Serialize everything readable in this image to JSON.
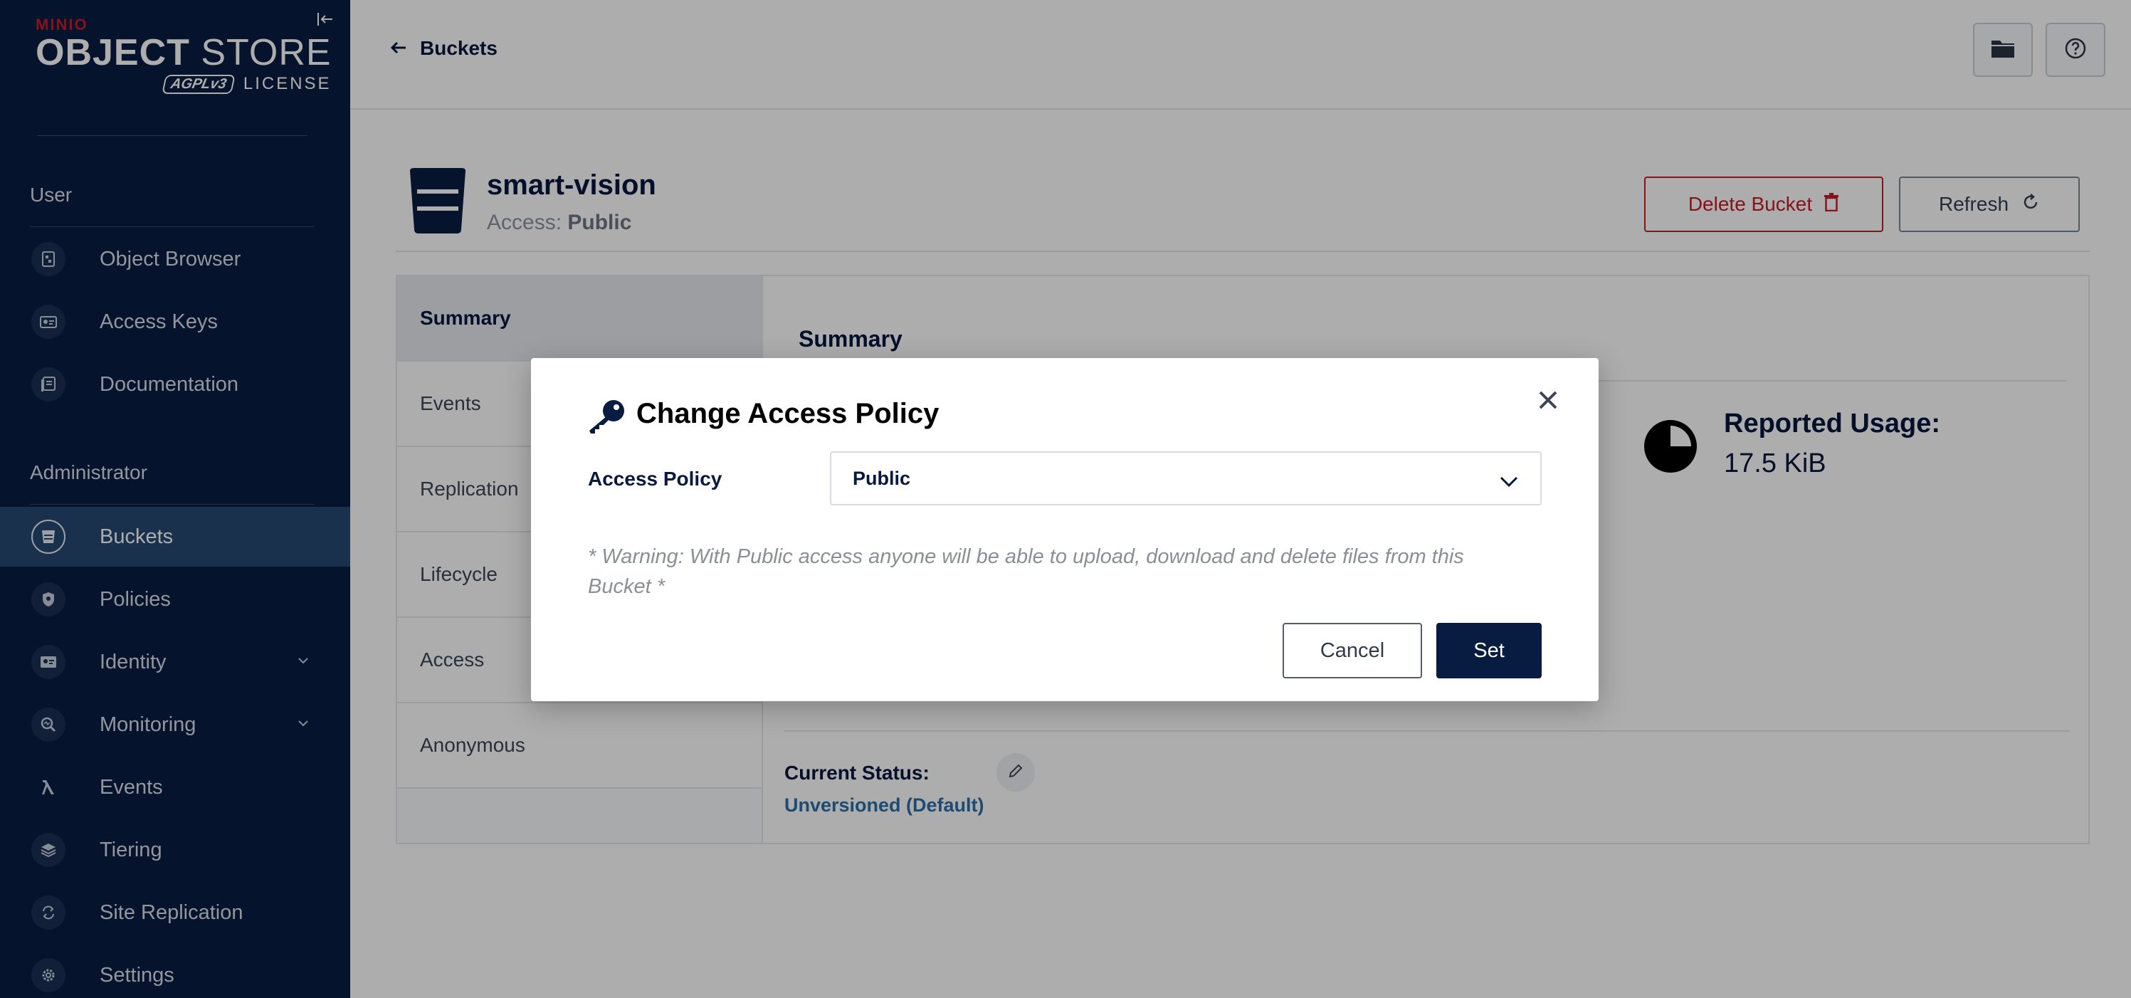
{
  "brand": {
    "minio": "MINIO",
    "object": "OBJECT",
    "store": " STORE",
    "agpl": "AGPLv3",
    "license": "LICENSE"
  },
  "sidebar": {
    "user_section": "User",
    "user_items": [
      {
        "label": "Object Browser",
        "icon": "object-browser-icon"
      },
      {
        "label": "Access Keys",
        "icon": "access-keys-icon"
      },
      {
        "label": "Documentation",
        "icon": "documentation-icon"
      }
    ],
    "admin_section": "Administrator",
    "admin_items": [
      {
        "label": "Buckets",
        "icon": "bucket-icon",
        "active": true
      },
      {
        "label": "Policies",
        "icon": "shield-icon"
      },
      {
        "label": "Identity",
        "icon": "identity-icon",
        "expandable": true
      },
      {
        "label": "Monitoring",
        "icon": "monitoring-icon",
        "expandable": true
      },
      {
        "label": "Events",
        "icon": "lambda-icon"
      },
      {
        "label": "Tiering",
        "icon": "tiering-icon"
      },
      {
        "label": "Site Replication",
        "icon": "site-replication-icon"
      },
      {
        "label": "Settings",
        "icon": "gear-icon"
      }
    ]
  },
  "topbar": {
    "back_label": "Buckets"
  },
  "bucket": {
    "name": "smart-vision",
    "access_prefix": "Access: ",
    "access_value": "Public",
    "delete_label": "Delete Bucket",
    "refresh_label": "Refresh"
  },
  "tabs": [
    "Summary",
    "Events",
    "Replication",
    "Lifecycle",
    "Access",
    "Anonymous"
  ],
  "summary": {
    "title": "Summary",
    "usage_label": "Reported Usage:",
    "usage_value": "17.5 KiB",
    "current_status_label": "Current Status:",
    "current_status_value": "Unversioned (Default)"
  },
  "modal": {
    "title": "Change Access Policy",
    "field_label": "Access Policy",
    "selected_value": "Public",
    "warning": "* Warning: With Public access anyone will be able to upload, download and delete files from this Bucket *",
    "cancel_label": "Cancel",
    "set_label": "Set"
  },
  "colors": {
    "sidebar_bg": "#081c42",
    "sidebar_active": "#274974",
    "brand_red": "#c51d2a",
    "primary": "#081c42",
    "link_blue": "#2d6fa8"
  }
}
